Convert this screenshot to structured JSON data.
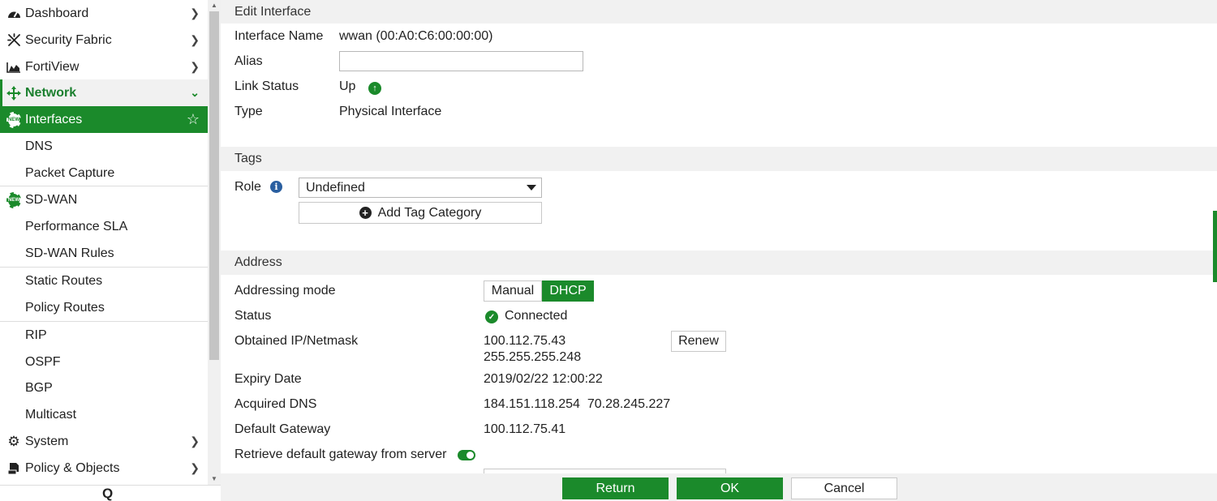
{
  "sidebar": {
    "items": [
      {
        "label": "Dashboard",
        "icon": "dashboard-icon"
      },
      {
        "label": "Security Fabric",
        "icon": "security-fabric-icon"
      },
      {
        "label": "FortiView",
        "icon": "fortiview-icon"
      },
      {
        "label": "Network",
        "icon": "network-icon"
      },
      {
        "label": "Interfaces",
        "icon": "new-badge-icon",
        "badge": "NEW"
      },
      {
        "label": "DNS"
      },
      {
        "label": "Packet Capture"
      },
      {
        "label": "SD-WAN",
        "icon": "new-badge-icon",
        "badge": "NEW"
      },
      {
        "label": "Performance SLA"
      },
      {
        "label": "SD-WAN Rules"
      },
      {
        "label": "Static Routes"
      },
      {
        "label": "Policy Routes"
      },
      {
        "label": "RIP"
      },
      {
        "label": "OSPF"
      },
      {
        "label": "BGP"
      },
      {
        "label": "Multicast"
      },
      {
        "label": "System",
        "icon": "gear-icon"
      },
      {
        "label": "Policy & Objects",
        "icon": "policy-icon"
      }
    ],
    "search_glyph": "Q"
  },
  "edit_interface": {
    "title": "Edit Interface",
    "name_label": "Interface Name",
    "name_value": "wwan (00:A0:C6:00:00:00)",
    "alias_label": "Alias",
    "alias_value": "",
    "link_status_label": "Link Status",
    "link_status_value": "Up",
    "type_label": "Type",
    "type_value": "Physical Interface"
  },
  "tags": {
    "title": "Tags",
    "role_label": "Role",
    "role_value": "Undefined",
    "add_tag_label": "Add Tag Category"
  },
  "address": {
    "title": "Address",
    "mode_label": "Addressing mode",
    "mode_options": [
      "Manual",
      "DHCP"
    ],
    "mode_selected": "DHCP",
    "status_label": "Status",
    "status_value": "Connected",
    "ip_label": "Obtained IP/Netmask",
    "ip_value": "100.112.75.43",
    "netmask_value": "255.255.255.248",
    "renew_label": "Renew",
    "expiry_label": "Expiry Date",
    "expiry_value": "2019/02/22 12:00:22",
    "dns_label": "Acquired DNS",
    "dns_value": "184.151.118.254  70.28.245.227",
    "gateway_label": "Default Gateway",
    "gateway_value": "100.112.75.41",
    "retrieve_label": "Retrieve default gateway from server",
    "retrieve_enabled": true
  },
  "footer": {
    "return_label": "Return",
    "ok_label": "OK",
    "cancel_label": "Cancel"
  },
  "colors": {
    "accent": "#1b8a2b",
    "section_bg": "#f1f1f1",
    "info": "#2a5fa0"
  }
}
